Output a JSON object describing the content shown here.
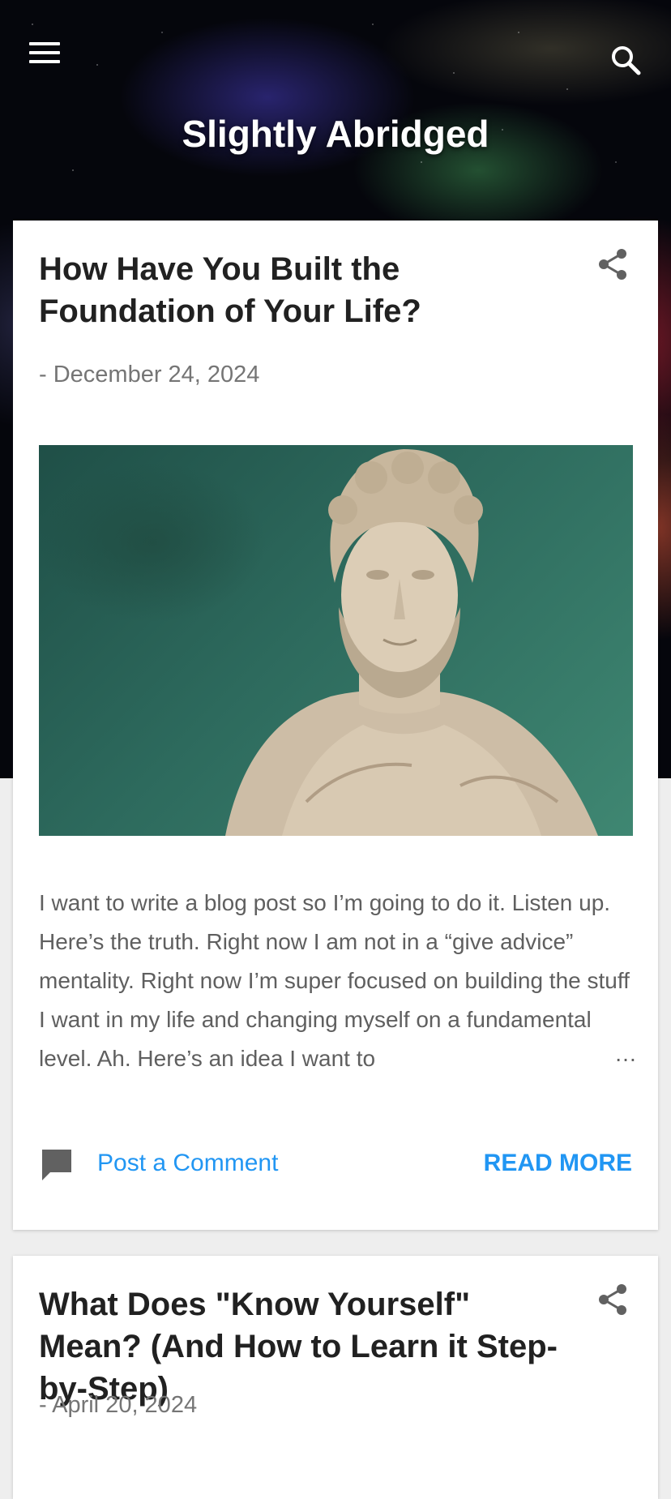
{
  "header": {
    "blog_title": "Slightly Abridged",
    "menu_icon": "hamburger-menu-icon",
    "search_icon": "search-icon"
  },
  "posts": [
    {
      "title": "How Have You Built the Foundation of Your Life?",
      "date": "- December 24, 2024",
      "image_alt": "Marble bust of a bearded man on a green background",
      "excerpt": "I want to write a blog post so I’m going to do it. Listen up. Here’s the truth. Right now I am not in a “give advice” mentality. Right now I’m super focused on building the stuff I want in my life and changing myself on a fundamental level. Ah. Here’s an idea I want to",
      "ellipsis": "…",
      "comment_label": "Post a Comment",
      "read_more_label": "READ MORE",
      "share_icon": "share-icon",
      "comment_icon": "comment-icon"
    },
    {
      "title": "What Does \"Know Yourself\" Mean? (And How to Learn it Step-by-Step)",
      "date": "- April 20, 2024",
      "share_icon": "share-icon"
    }
  ],
  "colors": {
    "accent": "#2196f3",
    "title_text": "#212121",
    "meta_text": "#757575",
    "body_text": "#5f5f5f",
    "page_bg": "#eeeeee"
  }
}
